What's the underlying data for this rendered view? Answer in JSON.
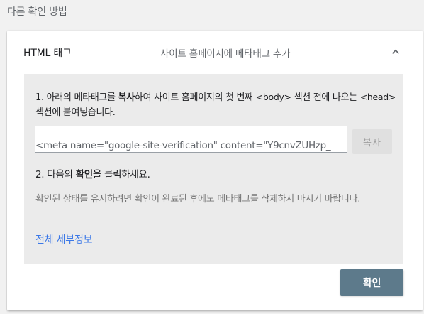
{
  "section_title": "다른 확인 방법",
  "method": {
    "name": "HTML 태그",
    "description": "사이트 홈페이지에 메타태그 추가",
    "expanded": true,
    "collapse_icon": "chevron-up-icon"
  },
  "instructions": {
    "step1": {
      "prefix": "1. 아래의 메타태그를 ",
      "emphasis": "복사",
      "middle": "하여 사이트 홈페이지의 첫 번째 ",
      "body_tag": "<body>",
      "middle2": " 섹션 전에 나오는 ",
      "head_tag": "<head>",
      "suffix": " 섹션에 붙여넣습니다."
    },
    "meta_tag_value": "<meta name=\"google-site-verification\" content=\"Y9cnvZUHzp_",
    "copy_button_label": "복사",
    "step2": {
      "prefix": "2. 다음의 ",
      "emphasis": "확인",
      "suffix": "을 클릭하세요."
    },
    "note": "확인된 상태를 유지하려면 확인이 완료된 후에도 메타태그를 삭제하지 마시기 바랍니다.",
    "details_link": "전체 세부정보"
  },
  "confirm_button_label": "확인",
  "colors": {
    "page_background": "#f1f1f1",
    "panel_background": "#ebebeb",
    "link": "#3b78e7",
    "confirm_button": "#5d7a8b",
    "copy_button": "#e0e0e0"
  }
}
